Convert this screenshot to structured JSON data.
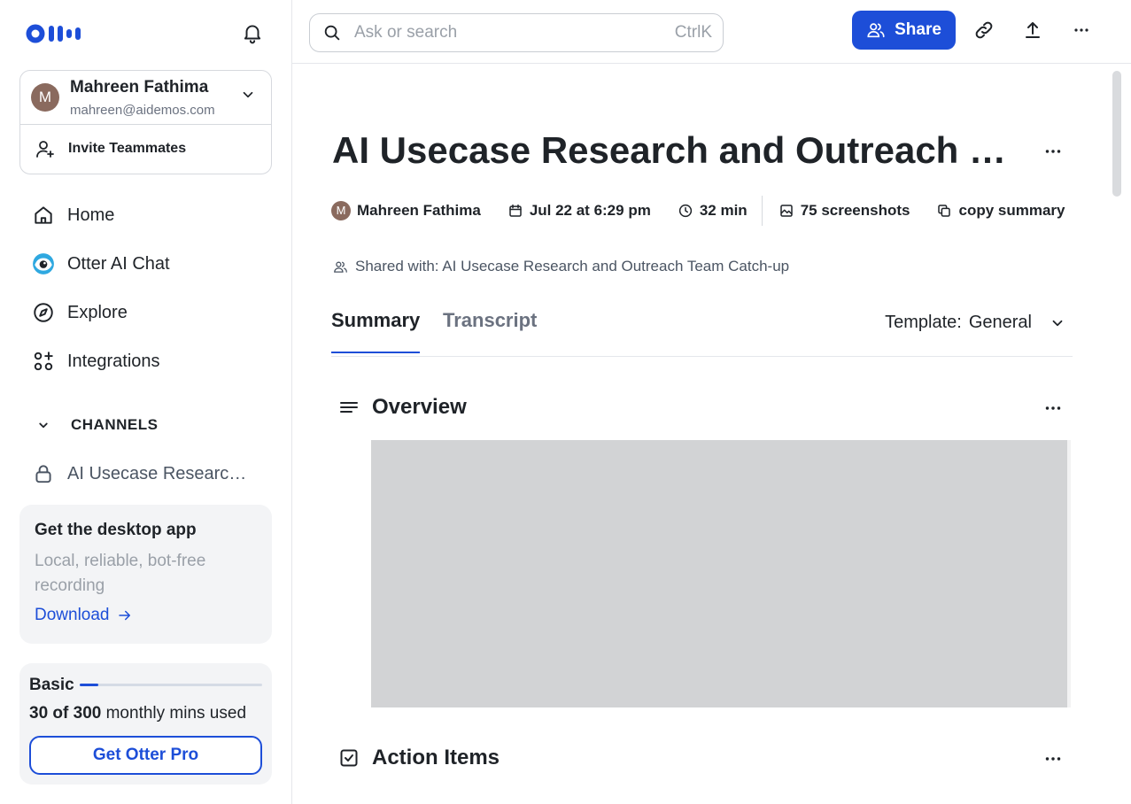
{
  "sidebar": {
    "account": {
      "avatar_initial": "M",
      "name": "Mahreen Fathima",
      "email": "mahreen@aidemos.com"
    },
    "invite_label": "Invite Teammates",
    "nav": {
      "home": "Home",
      "otter_ai_chat": "Otter AI Chat",
      "explore": "Explore",
      "integrations": "Integrations"
    },
    "channels_heading": "CHANNELS",
    "channel_item": "AI Usecase Research and Outreach Team Catch-up",
    "desktop_app": {
      "title": "Get the desktop app",
      "subtitle": "Local, reliable, bot-free recording",
      "link": "Download"
    },
    "plan": {
      "name": "Basic",
      "used": "30 of 300",
      "suffix": "monthly mins used",
      "used_fraction": 0.1,
      "cta": "Get Otter Pro"
    }
  },
  "topbar": {
    "search_placeholder": "Ask or search",
    "search_shortcut": "CtrlK",
    "share_label": "Share"
  },
  "document": {
    "title": "AI Usecase Research and Outreach Team Catch-up",
    "meta": {
      "author_initial": "M",
      "author": "Mahreen Fathima",
      "date": "Jul 22 at 6:29 pm",
      "duration": "32 min",
      "screenshots": "75 screenshots",
      "copy_summary": "copy summary"
    },
    "shared_with": "Shared with: AI Usecase Research and Outreach Team Catch-up",
    "tabs": [
      "Summary",
      "Transcript"
    ],
    "template_label": "Template:",
    "template_value": "General",
    "sections": {
      "overview": "Overview",
      "action_items": "Action Items"
    }
  },
  "colors": {
    "accent": "#1d4ed8",
    "avatar": "#8a6a5e",
    "redacted_block": "#d2d3d5"
  }
}
